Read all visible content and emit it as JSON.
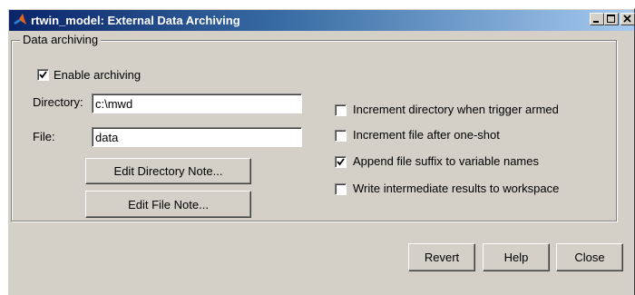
{
  "window": {
    "title": "rtwin_model: External Data Archiving"
  },
  "group": {
    "title": "Data archiving"
  },
  "enable_archiving": {
    "label": "Enable archiving",
    "checked": true
  },
  "directory": {
    "label": "Directory:",
    "value": "c:\\mwd"
  },
  "file": {
    "label": "File:",
    "value": "data"
  },
  "buttons": {
    "edit_directory_note": "Edit Directory Note...",
    "edit_file_note": "Edit File Note...",
    "revert": "Revert",
    "help": "Help",
    "close": "Close"
  },
  "options": [
    {
      "label": "Increment directory when trigger armed",
      "checked": false
    },
    {
      "label": "Increment file after one-shot",
      "checked": false
    },
    {
      "label": "Append file suffix to variable names",
      "checked": true
    },
    {
      "label": "Write intermediate results to workspace",
      "checked": false
    }
  ],
  "icons": {
    "app": "matlab-logo-icon",
    "minimize": "minimize-icon",
    "maximize": "maximize-icon",
    "close": "close-icon"
  }
}
